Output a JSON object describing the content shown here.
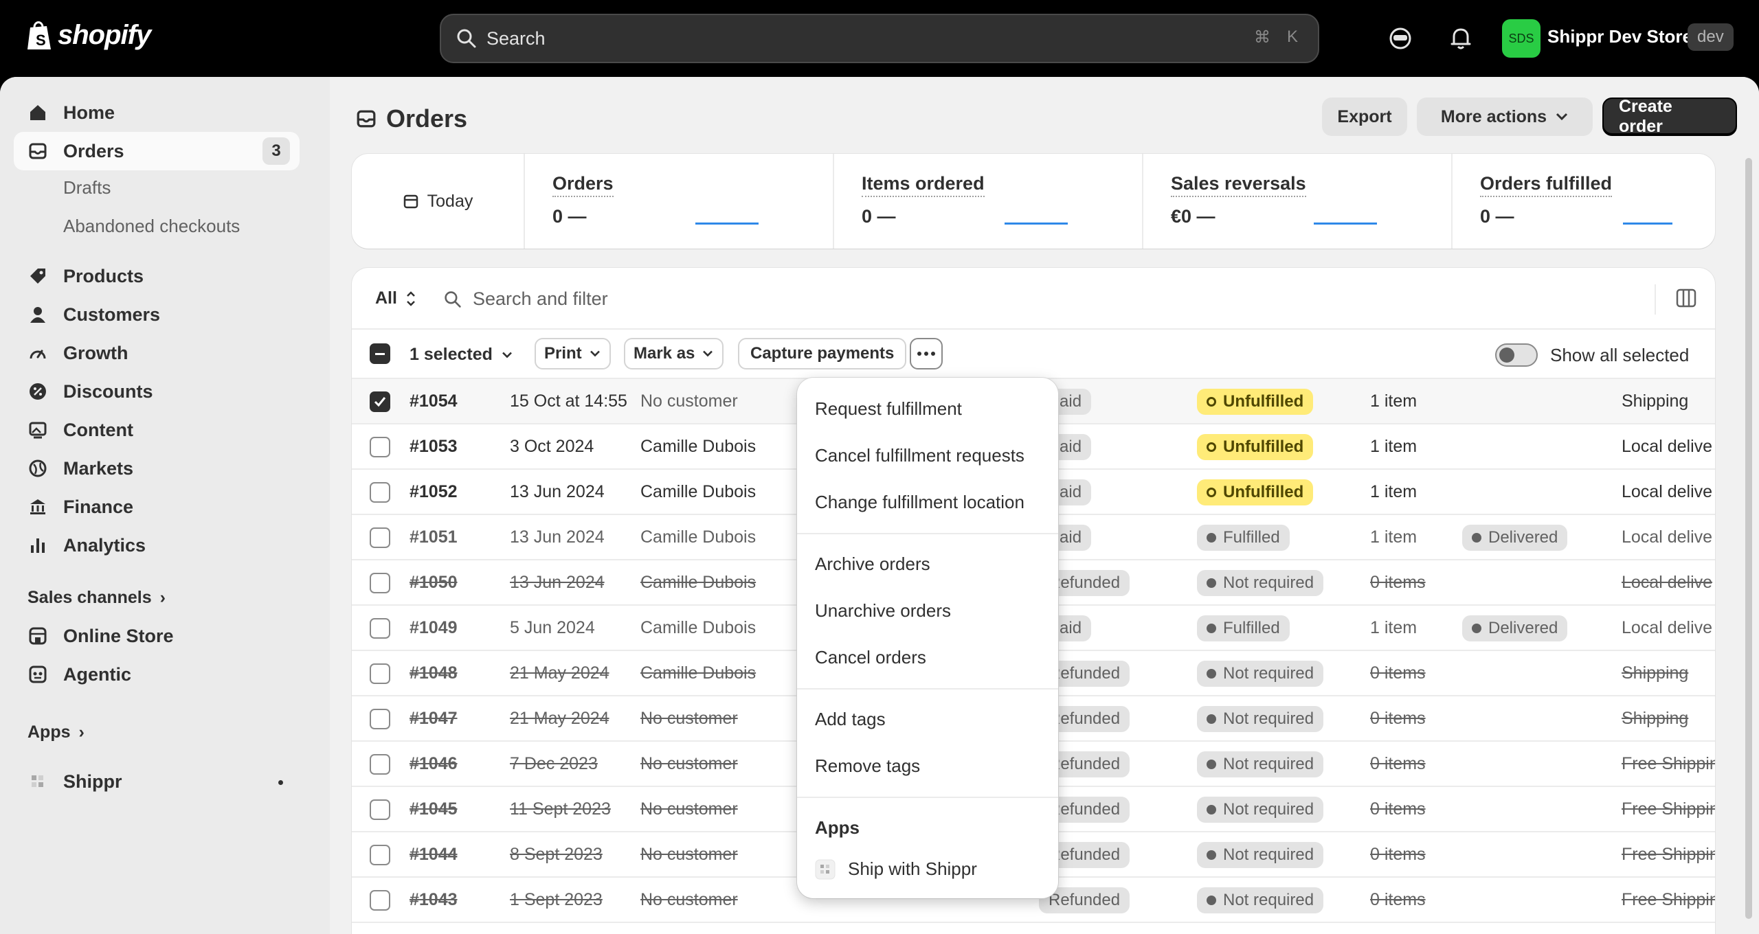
{
  "topbar": {
    "logo_text": "shopify",
    "search_placeholder": "Search",
    "kbd_cmd": "⌘",
    "kbd_key": "K",
    "store_badge": "SDS",
    "store_name": "Shippr Dev Store",
    "store_env": "dev"
  },
  "sidebar": {
    "home": "Home",
    "orders": "Orders",
    "orders_count": "3",
    "drafts": "Drafts",
    "abandoned": "Abandoned checkouts",
    "products": "Products",
    "customers": "Customers",
    "growth": "Growth",
    "discounts": "Discounts",
    "content": "Content",
    "markets": "Markets",
    "finance": "Finance",
    "analytics": "Analytics",
    "sales_channels": "Sales channels",
    "online_store": "Online Store",
    "agentic": "Agentic",
    "apps": "Apps",
    "shippr": "Shippr"
  },
  "page": {
    "title": "Orders",
    "export": "Export",
    "more_actions": "More actions",
    "create_order": "Create order"
  },
  "stats": {
    "today": "Today",
    "items": [
      {
        "label": "Orders",
        "value": "0 —"
      },
      {
        "label": "Items ordered",
        "value": "0 —"
      },
      {
        "label": "Sales reversals",
        "value": "€0 —"
      },
      {
        "label": "Orders fulfilled",
        "value": "0 —"
      }
    ]
  },
  "filter": {
    "all": "All",
    "search_placeholder": "Search and filter"
  },
  "bulk": {
    "selected": "1 selected",
    "print": "Print",
    "mark_as": "Mark as",
    "capture": "Capture payments",
    "show_all": "Show all selected"
  },
  "orders": [
    {
      "id": "#1054",
      "date": "15 Oct at 14:55",
      "customer": "No customer",
      "payment": "Paid",
      "fulfillment": "Unfulfilled",
      "items": "1 item",
      "delivery": "",
      "method": "Shipping",
      "archived": false,
      "selected": true
    },
    {
      "id": "#1053",
      "date": "3 Oct 2024",
      "customer": "Camille Dubois",
      "payment": "Paid",
      "fulfillment": "Unfulfilled",
      "items": "1 item",
      "delivery": "",
      "method": "Local delive",
      "archived": false,
      "selected": false
    },
    {
      "id": "#1052",
      "date": "13 Jun 2024",
      "customer": "Camille Dubois",
      "payment": "Paid",
      "fulfillment": "Unfulfilled",
      "items": "1 item",
      "delivery": "",
      "method": "Local delive",
      "archived": false,
      "selected": false
    },
    {
      "id": "#1051",
      "date": "13 Jun 2024",
      "customer": "Camille Dubois",
      "payment": "Paid",
      "fulfillment": "Fulfilled",
      "items": "1 item",
      "delivery": "Delivered",
      "method": "Local delive",
      "archived": false,
      "selected": false
    },
    {
      "id": "#1050",
      "date": "13 Jun 2024",
      "customer": "Camille Dubois",
      "payment": "Refunded",
      "fulfillment": "Not required",
      "items": "0 items",
      "delivery": "",
      "method": "Local delive",
      "archived": true,
      "selected": false
    },
    {
      "id": "#1049",
      "date": "5 Jun 2024",
      "customer": "Camille Dubois",
      "payment": "Paid",
      "fulfillment": "Fulfilled",
      "items": "1 item",
      "delivery": "Delivered",
      "method": "Local delive",
      "archived": false,
      "selected": false
    },
    {
      "id": "#1048",
      "date": "21 May 2024",
      "customer": "Camille Dubois",
      "payment": "Refunded",
      "fulfillment": "Not required",
      "items": "0 items",
      "delivery": "",
      "method": "Shipping",
      "archived": true,
      "selected": false
    },
    {
      "id": "#1047",
      "date": "21 May 2024",
      "customer": "No customer",
      "payment": "Refunded",
      "fulfillment": "Not required",
      "items": "0 items",
      "delivery": "",
      "method": "Shipping",
      "archived": true,
      "selected": false
    },
    {
      "id": "#1046",
      "date": "7 Dec 2023",
      "customer": "No customer",
      "payment": "Refunded",
      "fulfillment": "Not required",
      "items": "0 items",
      "delivery": "",
      "method": "Free Shippin",
      "archived": true,
      "selected": false
    },
    {
      "id": "#1045",
      "date": "11 Sept 2023",
      "customer": "No customer",
      "payment": "Refunded",
      "fulfillment": "Not required",
      "items": "0 items",
      "delivery": "",
      "method": "Free Shippin",
      "archived": true,
      "selected": false
    },
    {
      "id": "#1044",
      "date": "8 Sept 2023",
      "customer": "No customer",
      "payment": "Refunded",
      "fulfillment": "Not required",
      "items": "0 items",
      "delivery": "",
      "method": "Free Shippin",
      "archived": true,
      "selected": false
    },
    {
      "id": "#1043",
      "date": "1 Sept 2023",
      "customer": "No customer",
      "payment": "Refunded",
      "fulfillment": "Not required",
      "items": "0 items",
      "delivery": "",
      "method": "Free Shippin",
      "archived": true,
      "selected": false
    }
  ],
  "menu": {
    "request_fulfillment": "Request fulfillment",
    "cancel_fulfillment": "Cancel fulfillment requests",
    "change_location": "Change fulfillment location",
    "archive": "Archive orders",
    "unarchive": "Unarchive orders",
    "cancel_orders": "Cancel orders",
    "add_tags": "Add tags",
    "remove_tags": "Remove tags",
    "apps_heading": "Apps",
    "ship_with_shippr": "Ship with Shippr"
  }
}
